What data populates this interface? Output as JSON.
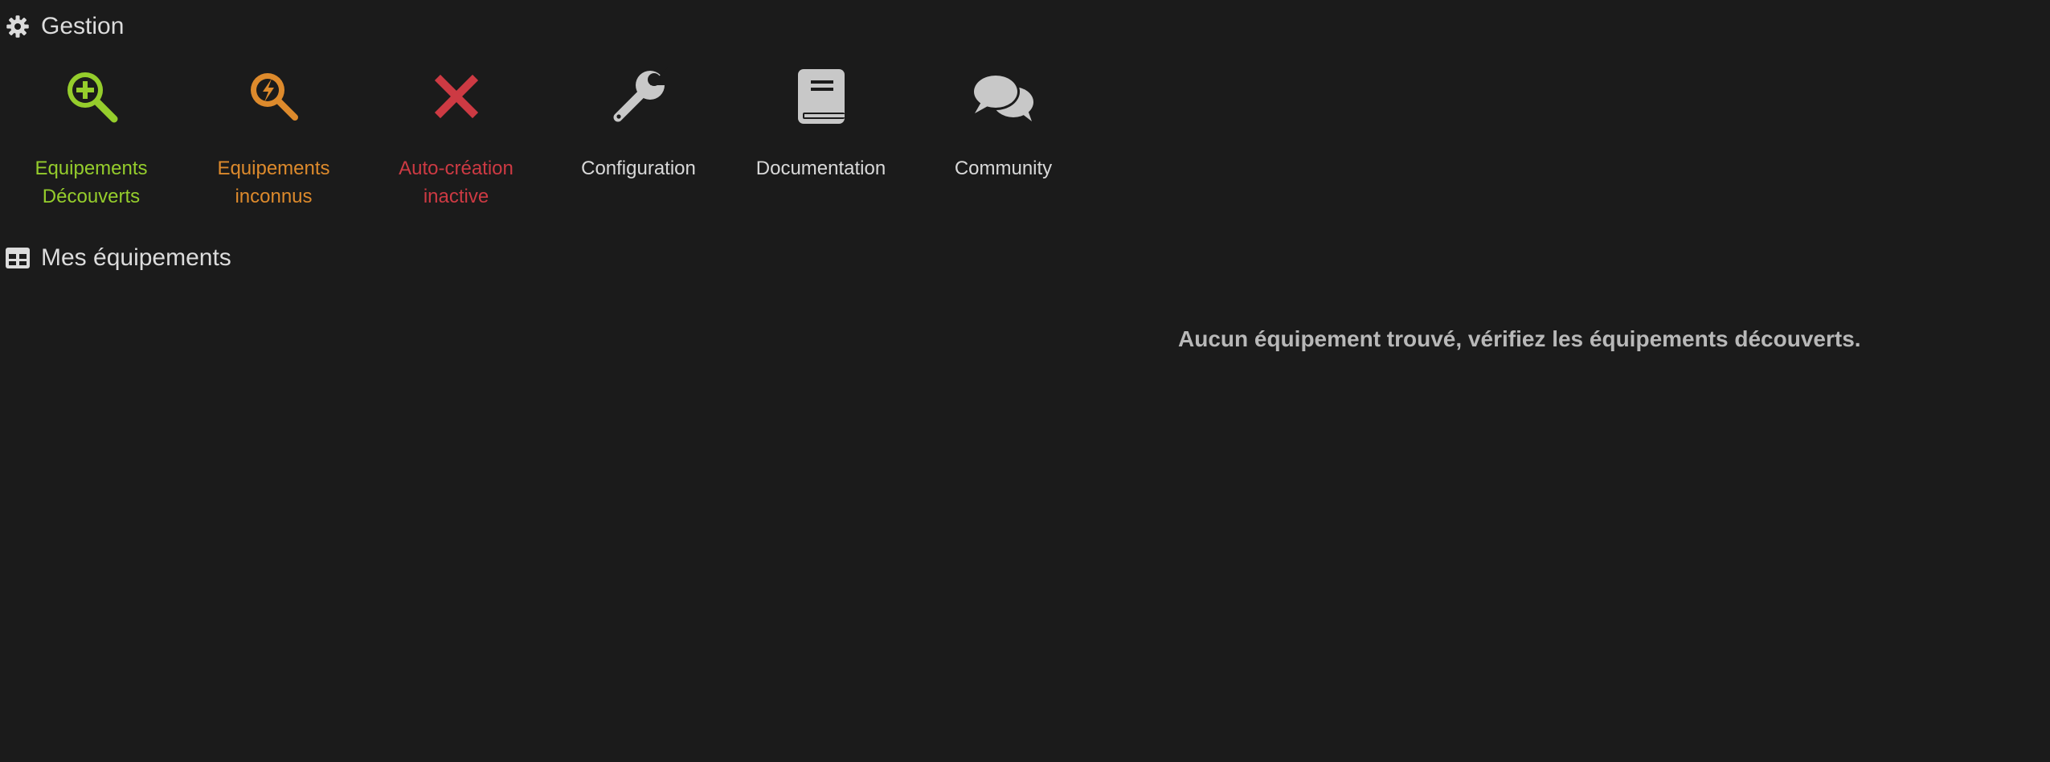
{
  "sections": {
    "gestion": {
      "title": "Gestion",
      "icon": "gear-icon"
    },
    "mes_equipements": {
      "title": "Mes équipements",
      "icon": "table-icon"
    }
  },
  "actions": [
    {
      "label": "Equipements\nDécouverts",
      "icon": "search-plus-icon",
      "color": "#95cd2c"
    },
    {
      "label": "Equipements\ninconnus",
      "icon": "search-unknown-icon",
      "color": "#dd8a2c"
    },
    {
      "label": "Auto-création\ninactive",
      "icon": "cross-icon",
      "color": "#cd3a43"
    },
    {
      "label": "Configuration",
      "icon": "wrench-icon",
      "color": "#d9d9d9"
    },
    {
      "label": "Documentation",
      "icon": "book-icon",
      "color": "#d9d9d9"
    },
    {
      "label": "Community",
      "icon": "chat-bubbles-icon",
      "color": "#d9d9d9"
    }
  ],
  "empty_message": "Aucun équipement trouvé, vérifiez les équipements découverts."
}
